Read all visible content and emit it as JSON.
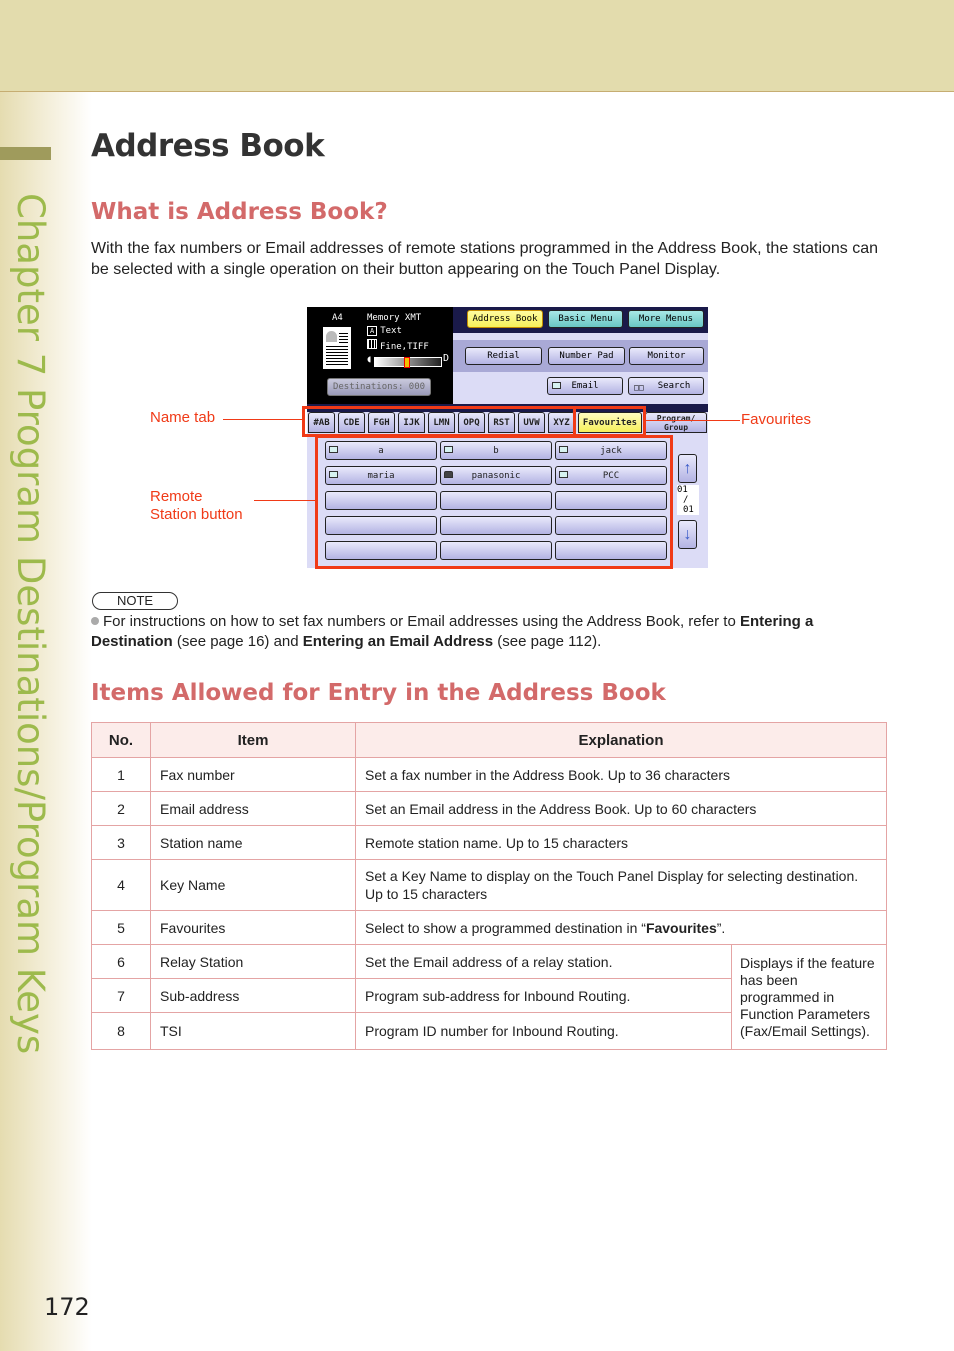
{
  "sidebar": {
    "chapter_label": "Chapter 7   Program Destinations/Program Keys",
    "page_number": "172"
  },
  "header": {
    "title": "Address Book"
  },
  "section1": {
    "heading": "What is Address Book?",
    "body": "With the fax numbers or Email addresses of remote stations programmed in the Address Book, the stations can be selected with a single operation on their button appearing on the Touch Panel Display."
  },
  "panel": {
    "paper_size": "A4",
    "mode": "Memory XMT",
    "original_type": "Text",
    "resolution": "Fine,TIFF",
    "contrast_level": 0.5,
    "destinations_button": "Destinations: 000",
    "top_buttons": [
      "Address Book",
      "Basic Menu",
      "More Menus"
    ],
    "mid_buttons": [
      "Redial",
      "Number Pad",
      "Monitor"
    ],
    "email_button": "Email",
    "search_button": "Search",
    "tabs": [
      "#AB",
      "CDE",
      "FGH",
      "IJK",
      "LMN",
      "OPQ",
      "RST",
      "UVW",
      "XYZ",
      "Favourites"
    ],
    "program_group_tab": [
      "Program/",
      "Group"
    ],
    "stations": [
      {
        "name": "a",
        "type": "email"
      },
      {
        "name": "b",
        "type": "email"
      },
      {
        "name": "jack",
        "type": "email"
      },
      {
        "name": "maria",
        "type": "email"
      },
      {
        "name": "panasonic",
        "type": "fax"
      },
      {
        "name": "PCC",
        "type": "email"
      }
    ],
    "page_current": "01",
    "page_separator": "/",
    "page_total": "01",
    "accent_colors": {
      "callout_red": "#f03a17",
      "favourites_yellow": "#f6f05a",
      "teal": "#69c6c4"
    }
  },
  "callouts": {
    "name_tab": "Name tab",
    "remote_station": [
      "Remote",
      "Station button"
    ],
    "favourites": "Favourites"
  },
  "note": {
    "badge": "NOTE",
    "text_before": "For instructions on how to set fax numbers or Email addresses using the Address Book, refer to ",
    "link1": "Entering a Destination",
    "text_mid": " (see page 16) and ",
    "link2": "Entering an Email Address",
    "text_after": " (see page 112)."
  },
  "section2": {
    "heading": "Items Allowed for Entry in the Address Book",
    "columns": [
      "No.",
      "Item",
      "Explanation"
    ],
    "rows": [
      {
        "no": "1",
        "item": "Fax number",
        "explanation": "Set a fax number in the Address Book. Up to 36 characters"
      },
      {
        "no": "2",
        "item": "Email address",
        "explanation": "Set an Email address in the Address Book. Up to 60 characters"
      },
      {
        "no": "3",
        "item": "Station name",
        "explanation": "Remote station name. Up to 15 characters"
      },
      {
        "no": "4",
        "item": "Key Name",
        "explanation": "Set a Key Name to display on the Touch Panel Display for selecting destination. Up to 15 characters"
      },
      {
        "no": "5",
        "item": "Favourites",
        "explanation_before": "Select to show a programmed destination in “",
        "explanation_bold": "Favourites",
        "explanation_after": "”."
      },
      {
        "no": "6",
        "item": "Relay Station",
        "explanation": "Set the Email address of a relay station."
      },
      {
        "no": "7",
        "item": "Sub-address",
        "explanation": "Program sub-address for Inbound Routing."
      },
      {
        "no": "8",
        "item": "TSI",
        "explanation": "Program ID number for Inbound Routing."
      }
    ],
    "shared_note": "Displays if the feature has been programmed in Function Parameters (Fax/Email Settings)."
  }
}
